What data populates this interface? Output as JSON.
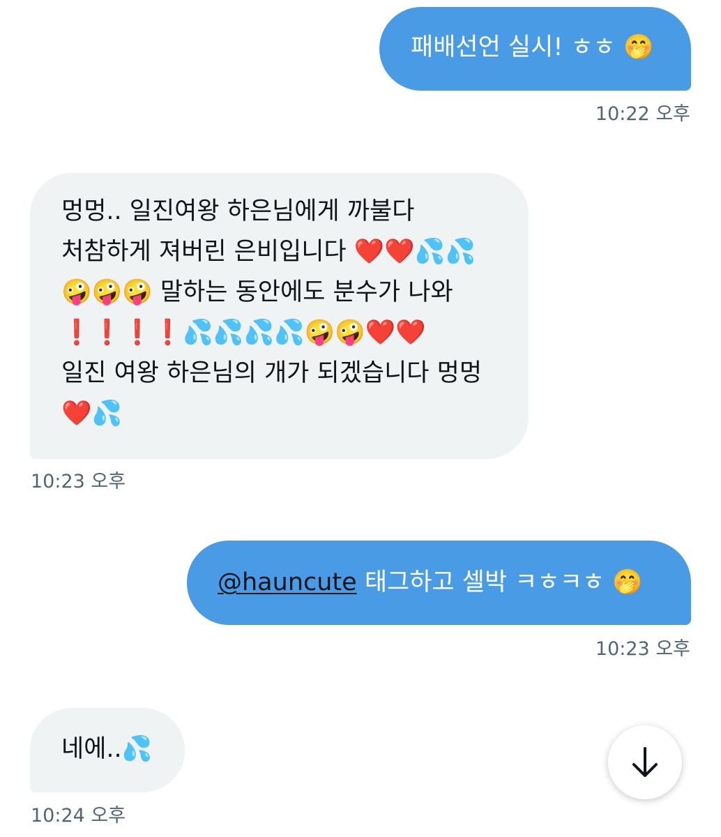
{
  "messages": [
    {
      "direction": "sent",
      "text": "패배선언 실시! ㅎㅎ 🤭",
      "time": "10:22 오후"
    },
    {
      "direction": "received",
      "lines": [
        "멍멍.. 일진여왕 하은님에게 까불다",
        "처참하게 져버린 은비입니다 ❤️❤️💦💦",
        "🤪🤪🤪 말하는 동안에도 분수가 나와",
        "❗❗❗❗💦💦💦💦🤪🤪❤️❤️",
        "일진 여왕 하은님의 개가 되겠습니다 멍멍",
        "❤️💦"
      ],
      "time": "10:23 오후"
    },
    {
      "direction": "sent",
      "mention": "@hauncute",
      "text": " 태그하고 셀박 ㅋㅎㅋㅎ 🤭",
      "time": "10:23 오후"
    },
    {
      "direction": "received",
      "text": "네에..💦",
      "time": "10:24 오후"
    }
  ],
  "scroll_button": {
    "icon": "arrow-down-icon"
  },
  "colors": {
    "sent_bubble": "#4a9be6",
    "received_bubble": "#eff3f4",
    "timestamp": "#536471"
  }
}
